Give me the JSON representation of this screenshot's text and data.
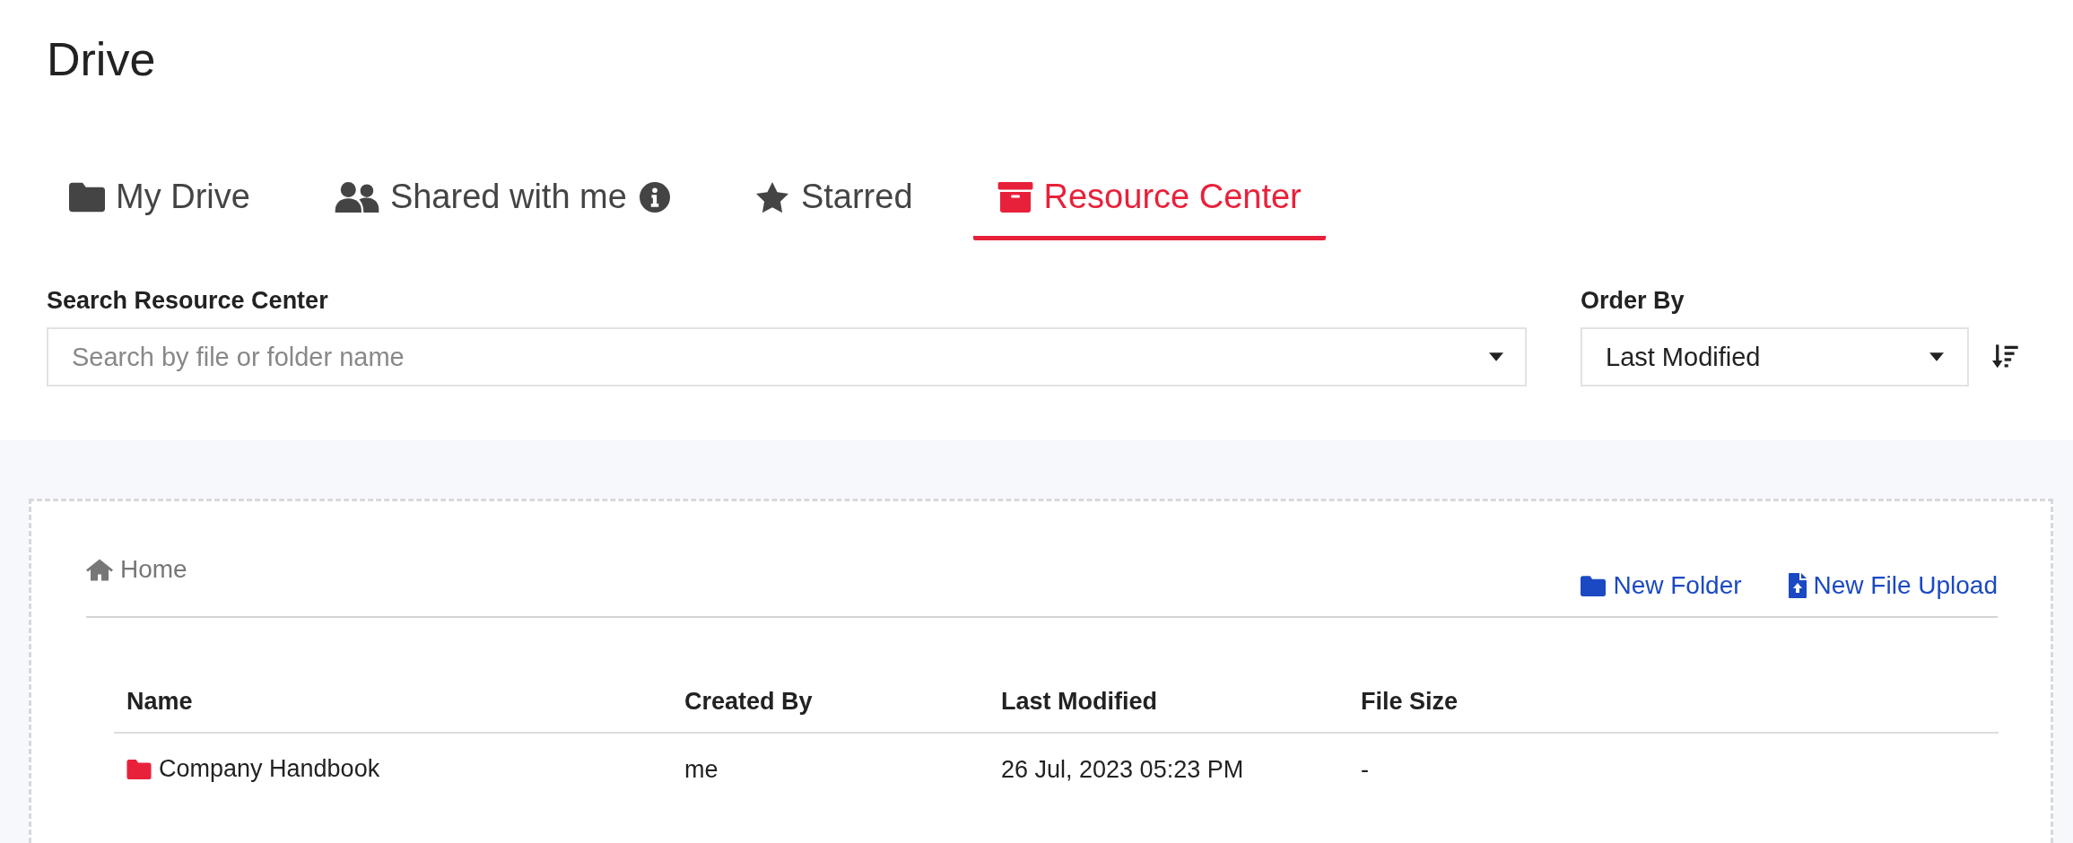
{
  "page_title": "Drive",
  "tabs": [
    {
      "label": "My Drive",
      "kind": "folder",
      "info": false,
      "selected": false
    },
    {
      "label": "Shared with me",
      "kind": "users",
      "info": true,
      "selected": false
    },
    {
      "label": "Starred",
      "kind": "star",
      "info": false,
      "selected": false
    },
    {
      "label": "Resource Center",
      "kind": "archive",
      "info": false,
      "selected": true
    }
  ],
  "search": {
    "label": "Search Resource Center",
    "placeholder": "Search by file or folder name"
  },
  "order_by": {
    "label": "Order By",
    "value": "Last Modified"
  },
  "breadcrumb": "Home",
  "actions": [
    {
      "label": "New Folder",
      "kind": "folder"
    },
    {
      "label": "New File Upload",
      "kind": "upload"
    }
  ],
  "table": {
    "columns": [
      "Name",
      "Created By",
      "Last Modified",
      "File Size"
    ],
    "rows": [
      {
        "name": "Company Handbook",
        "created_by": "me",
        "last_modified": "26 Jul, 2023 05:23 PM",
        "file_size": "-"
      }
    ]
  }
}
